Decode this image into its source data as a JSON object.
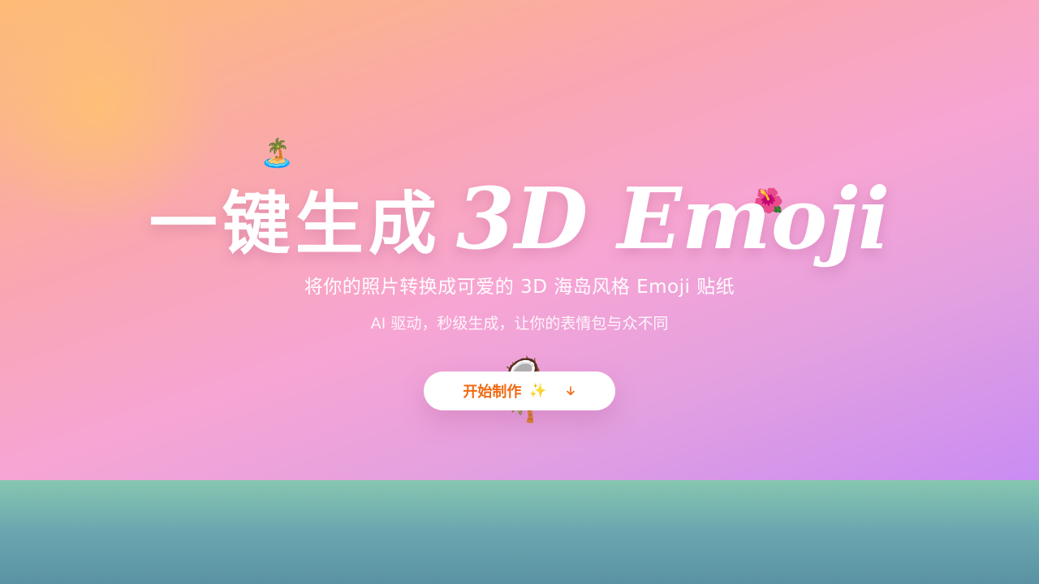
{
  "hero": {
    "title_cn": "一键生成",
    "title_en": "3D Emoji",
    "subtitle": "将你的照片转换成可爱的 3D 海岛风格 Emoji 贴纸",
    "tagline": "AI 驱动，秒级生成，让你的表情包与众不同",
    "decorations": {
      "island": "🏝️",
      "hibiscus": "🌺",
      "coconut": "🥥",
      "palm": "🌴"
    }
  },
  "cta": {
    "label": "开始制作",
    "sparkle": "✨",
    "sparkle_icon_name": "sparkles-icon",
    "arrow_icon_name": "arrow-down-icon"
  },
  "colors": {
    "cta_text": "#f06a12",
    "gradient_start": "#fdbb76",
    "gradient_mid": "#f7a5d3",
    "gradient_end": "#c98cf3",
    "ocean_band": "#6aa6b0"
  }
}
